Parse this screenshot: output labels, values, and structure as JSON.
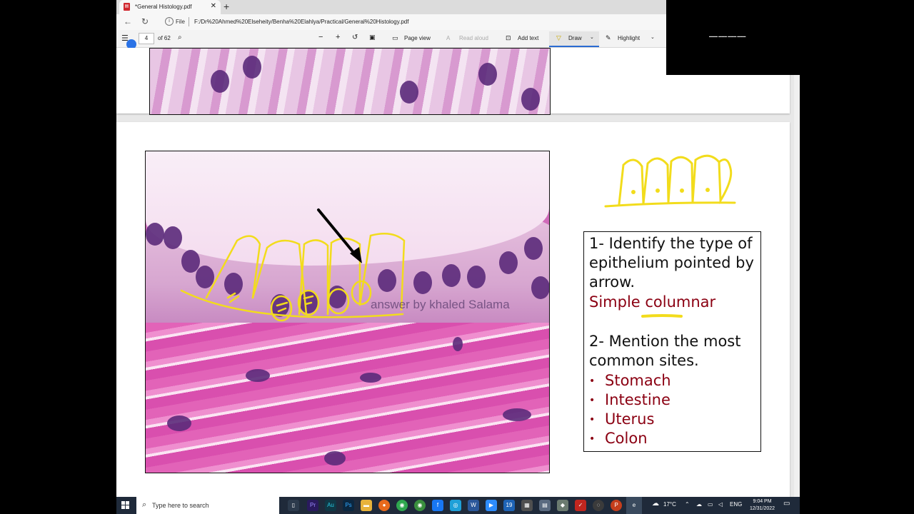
{
  "browser": {
    "tab_title": "*General Histology.pdf",
    "tab_close": "✕",
    "new_tab": "+",
    "address_file_label": "File",
    "address_url": "F:/Dr%20Ahmed%20Elseheity/Benha%20Elahlya/Practical/General%20Histology.pdf"
  },
  "pdf_toolbar": {
    "page_number": "4",
    "page_count": "of 62",
    "zoom_out": "−",
    "zoom_in": "+",
    "page_view": "Page view",
    "read_aloud": "Read aloud",
    "add_text": "Add text",
    "draw": "Draw",
    "highlight": "Highlight"
  },
  "slide": {
    "watermark": "answer by khaled Salama",
    "question1": [
      "1- Identify the type of",
      "epithelium pointed by",
      "arrow."
    ],
    "answer1": "Simple columnar",
    "question2": [
      "2- Mention the most",
      "common sites."
    ],
    "sites": [
      "Stomach",
      "Intestine",
      "Uterus",
      "Colon"
    ],
    "annotation_color": "#f2dc1c",
    "answer_color": "#8b0012"
  },
  "taskbar": {
    "search_placeholder": "Type here to search",
    "weather": "17°C",
    "language": "ENG",
    "time": "9:04 PM",
    "date": "12/31/2022"
  }
}
